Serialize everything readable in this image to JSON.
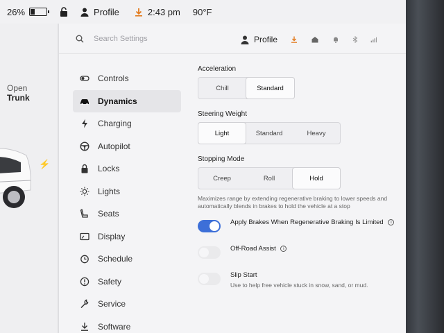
{
  "status": {
    "battery_percent": "26%",
    "battery_level": 0.26,
    "profile_label": "Profile",
    "time": "2:43 pm",
    "temperature": "90°F"
  },
  "car": {
    "trunk_line1": "Open",
    "trunk_line2": "Trunk"
  },
  "search": {
    "placeholder": "Search Settings",
    "profile_label": "Profile"
  },
  "nav": {
    "items": [
      {
        "label": "Controls",
        "icon": "toggle-icon"
      },
      {
        "label": "Dynamics",
        "icon": "car-icon"
      },
      {
        "label": "Charging",
        "icon": "bolt-icon"
      },
      {
        "label": "Autopilot",
        "icon": "steering-wheel-icon"
      },
      {
        "label": "Locks",
        "icon": "lock-icon"
      },
      {
        "label": "Lights",
        "icon": "sun-icon"
      },
      {
        "label": "Seats",
        "icon": "seat-icon"
      },
      {
        "label": "Display",
        "icon": "display-icon"
      },
      {
        "label": "Schedule",
        "icon": "clock-icon"
      },
      {
        "label": "Safety",
        "icon": "alert-icon"
      },
      {
        "label": "Service",
        "icon": "wrench-icon"
      },
      {
        "label": "Software",
        "icon": "download-icon"
      }
    ],
    "active": "Dynamics"
  },
  "acceleration": {
    "title": "Acceleration",
    "options": [
      "Chill",
      "Standard"
    ],
    "selected": "Standard"
  },
  "steering": {
    "title": "Steering Weight",
    "options": [
      "Light",
      "Standard",
      "Heavy"
    ],
    "selected": "Light"
  },
  "stopping": {
    "title": "Stopping Mode",
    "options": [
      "Creep",
      "Roll",
      "Hold"
    ],
    "selected": "Hold",
    "description": "Maximizes range by extending regenerative braking to lower speeds and automatically blends in brakes to hold the vehicle at a stop"
  },
  "toggles": {
    "apply_brakes": {
      "label": "Apply Brakes When Regenerative Braking Is Limited",
      "on": true
    },
    "offroad": {
      "label": "Off-Road Assist",
      "on": false
    },
    "slip_start": {
      "label": "Slip Start",
      "sub": "Use to help free vehicle stuck in snow, sand, or mud.",
      "on": false
    }
  },
  "colors": {
    "accent": "#3d6fd8",
    "download": "#e27a1d"
  }
}
